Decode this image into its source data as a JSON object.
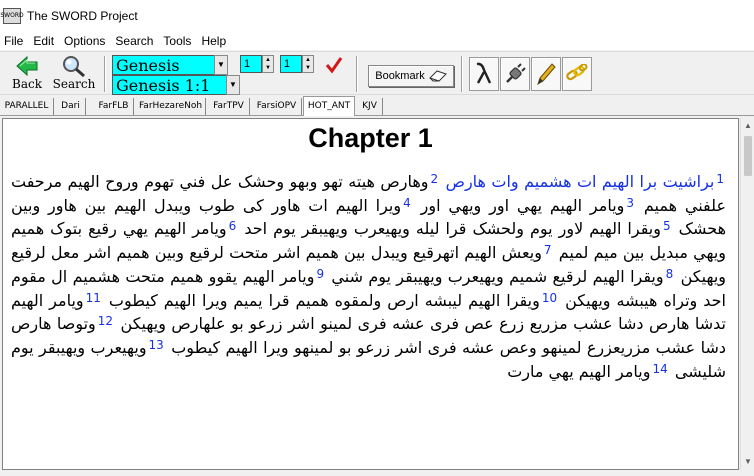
{
  "window": {
    "title": "The SWORD Project",
    "icon_text": "SWORD"
  },
  "menu": [
    "File",
    "Edit",
    "Options",
    "Search",
    "Tools",
    "Help"
  ],
  "toolbar": {
    "back_label": "Back",
    "search_label": "Search",
    "book": "Genesis",
    "reference": "Genesis 1:1",
    "chapter": "1",
    "verse": "1",
    "bookmark_label": "Bookmark",
    "accent_color": "#00ffff"
  },
  "tabs": [
    "PARALLEL",
    "Dari",
    "FarFLB",
    "FarHezareNoh",
    "FarTPV",
    "FarsiOPV",
    "HOT_ANT",
    "KJV"
  ],
  "active_tab": "HOT_ANT",
  "content": {
    "chapter_title": "Chapter 1",
    "verses": [
      {
        "n": "1",
        "text": "براشيت برا الهيم ات هشميم وات هارص"
      },
      {
        "n": "2",
        "text": "وهارص هيته تهو وبهو وحشک عل فني تهوم وروح الهيم مرحفت علفني هميم"
      },
      {
        "n": "3",
        "text": "ويامر الهيم يهي اور ويهي اور"
      },
      {
        "n": "4",
        "text": "ويرا الهيم ات هاور کی طوب ويبدل الهيم بين هاور وبين هحشک"
      },
      {
        "n": "5",
        "text": "ويقرا الهيم لاور يوم ولحشک قرا ليله ويهيعرب ويهيبقر يوم احد"
      },
      {
        "n": "6",
        "text": "ويامر الهيم يهي رقيع بتوک هميم ويهي مبديل بين ميم لميم"
      },
      {
        "n": "7",
        "text": "ويعش الهيم اتهرقيع ويبدل بين هميم اشر متحت لرقيع وبين هميم اشر معل لرقيع ويهيکن"
      },
      {
        "n": "8",
        "text": "ويقرا الهيم لرقيع شميم ويهيعرب ويهيبقر يوم شني"
      },
      {
        "n": "9",
        "text": "ويامر الهيم يقوو هميم متحت هشميم ال مقوم احد وتراه هيبشه ويهيکن"
      },
      {
        "n": "10",
        "text": "ويقرا الهيم ليبشه ارص ولمقوه هميم قرا يميم ويرا الهيم کيطوب"
      },
      {
        "n": "11",
        "text": "ويامر الهيم تدشا هارص دشا عشب مزريع زرع عص فری عشه فری لمينو اشر زرعو بو علهارص ويهيکن"
      },
      {
        "n": "12",
        "text": "وتوصا هارص دشا عشب مزريعزرع لمينهو وعص عشه فری اشر زرعو بو لمينهو ويرا الهيم کيطوب"
      },
      {
        "n": "13",
        "text": "ويهيعرب ويهيبقر يوم شليشی"
      },
      {
        "n": "14",
        "text": "ويامر الهيم يهي مارت"
      }
    ]
  }
}
